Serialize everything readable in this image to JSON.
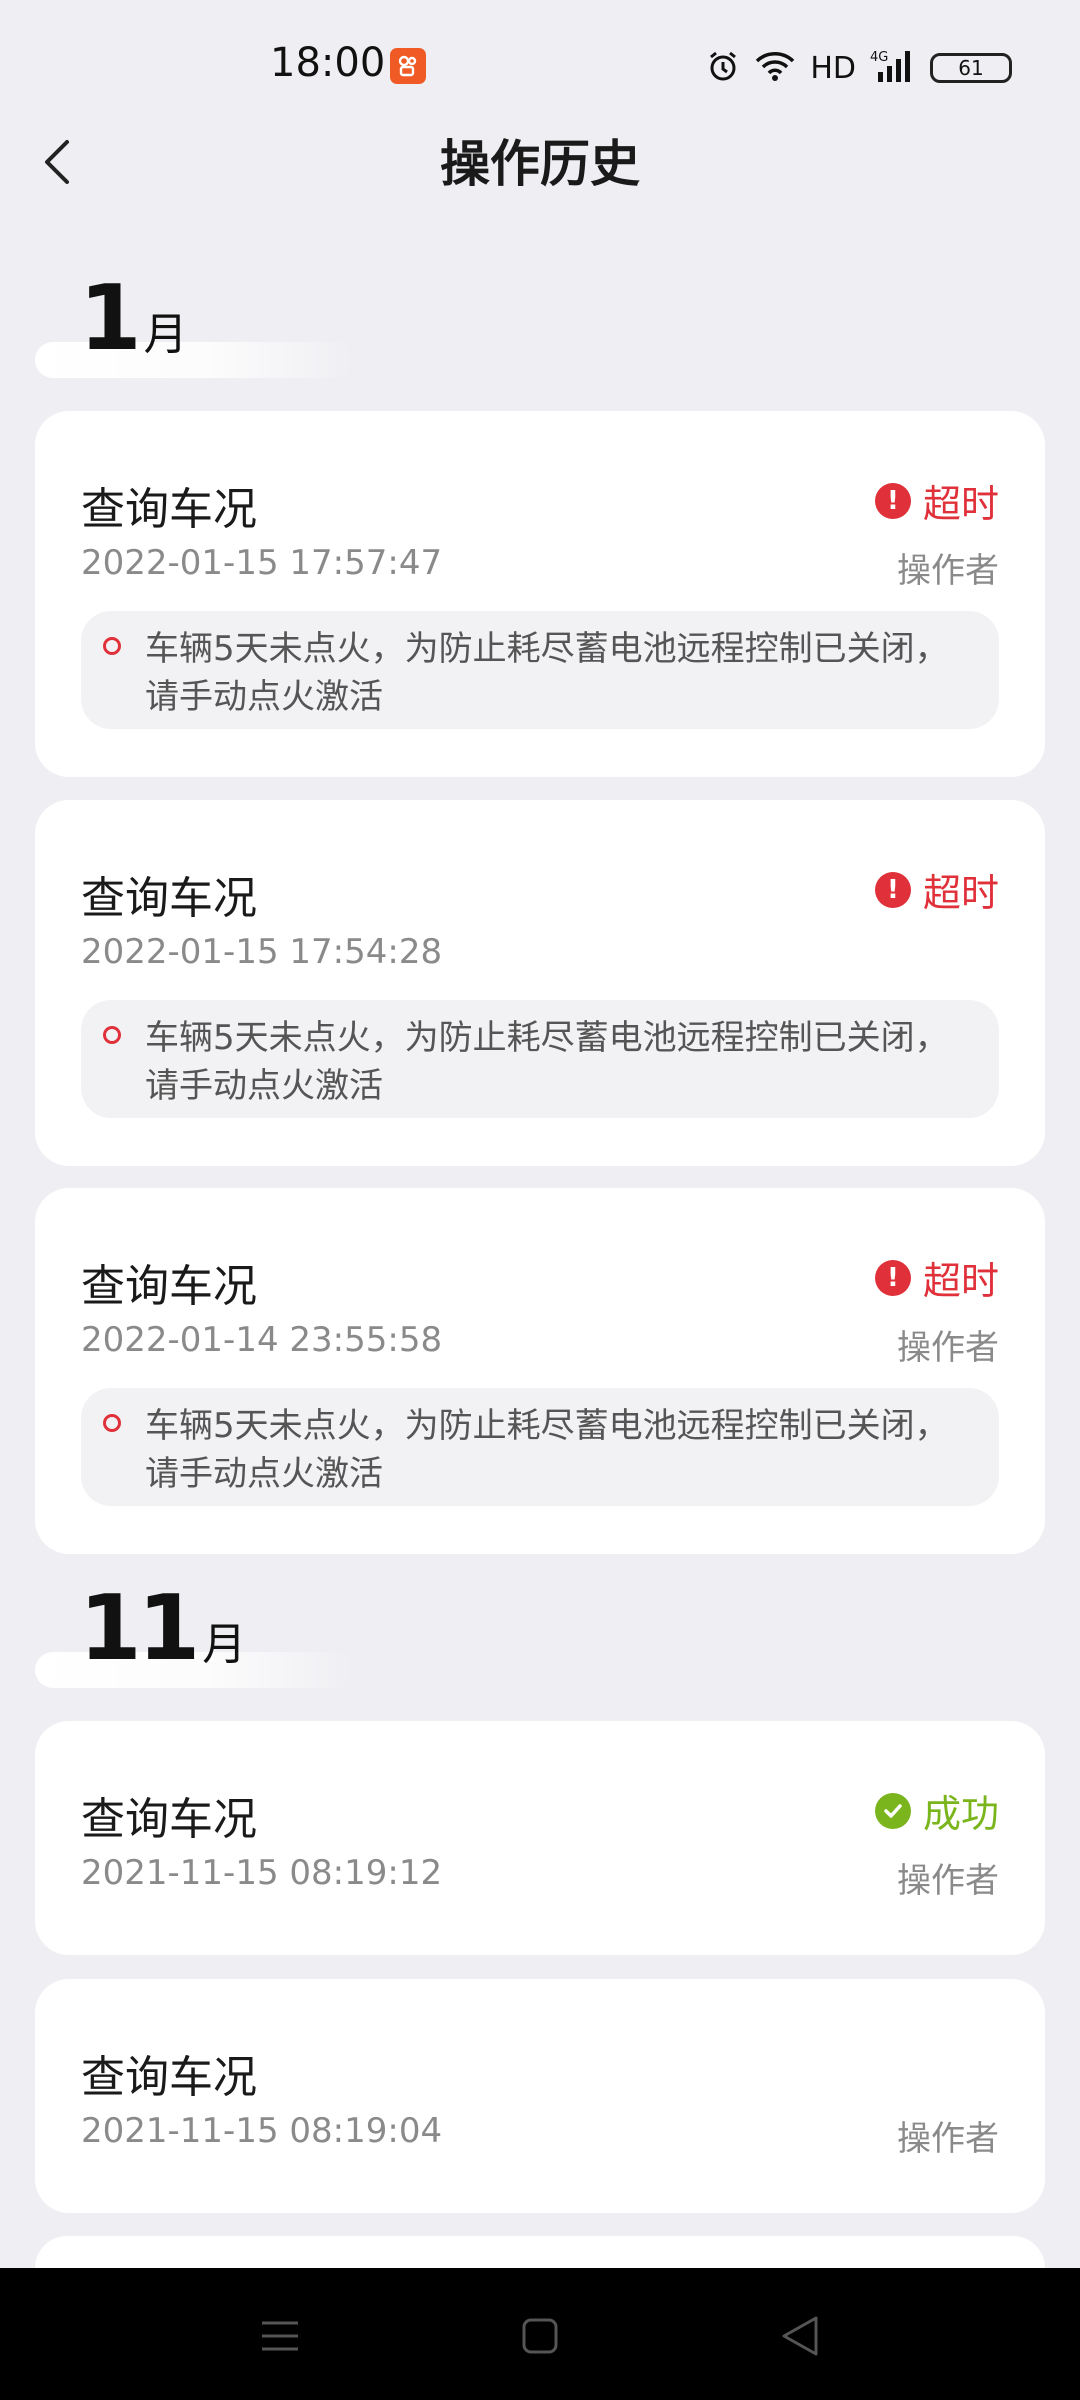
{
  "status_bar": {
    "time": "18:00",
    "app_icon": "kuaishou-icon",
    "hd": "HD",
    "network": "4G",
    "battery": "61"
  },
  "header": {
    "title": "操作历史",
    "back_icon": "chevron-left-icon"
  },
  "sections": [
    {
      "month": "1",
      "unit": "月",
      "records": [
        {
          "title": "查询车况",
          "time": "2022-01-15 17:57:47",
          "status": "超时",
          "operator": "操作者",
          "message": "车辆5天未点火，为防止耗尽蓄电池远程控制已关闭，请手动点火激活"
        },
        {
          "title": "查询车况",
          "time": "2022-01-15 17:54:28",
          "status": "超时",
          "operator": "",
          "message": "车辆5天未点火，为防止耗尽蓄电池远程控制已关闭，请手动点火激活"
        },
        {
          "title": "查询车况",
          "time": "2022-01-14 23:55:58",
          "status": "超时",
          "operator": "操作者",
          "message": "车辆5天未点火，为防止耗尽蓄电池远程控制已关闭，请手动点火激活"
        }
      ]
    },
    {
      "month": "11",
      "unit": "月",
      "records": [
        {
          "title": "查询车况",
          "time": "2021-11-15 08:19:12",
          "status": "成功",
          "operator": "操作者"
        },
        {
          "title": "查询车况",
          "time": "2021-11-15 08:19:04",
          "status": "",
          "operator": "操作者"
        }
      ]
    }
  ],
  "colors": {
    "background": "#efeff3",
    "timeout": "#e0313a",
    "success": "#7ab51d",
    "secondary_text": "#8a8a8a"
  },
  "nav_bar": {
    "icons": [
      "menu-icon",
      "home-square-icon",
      "back-triangle-icon"
    ]
  }
}
